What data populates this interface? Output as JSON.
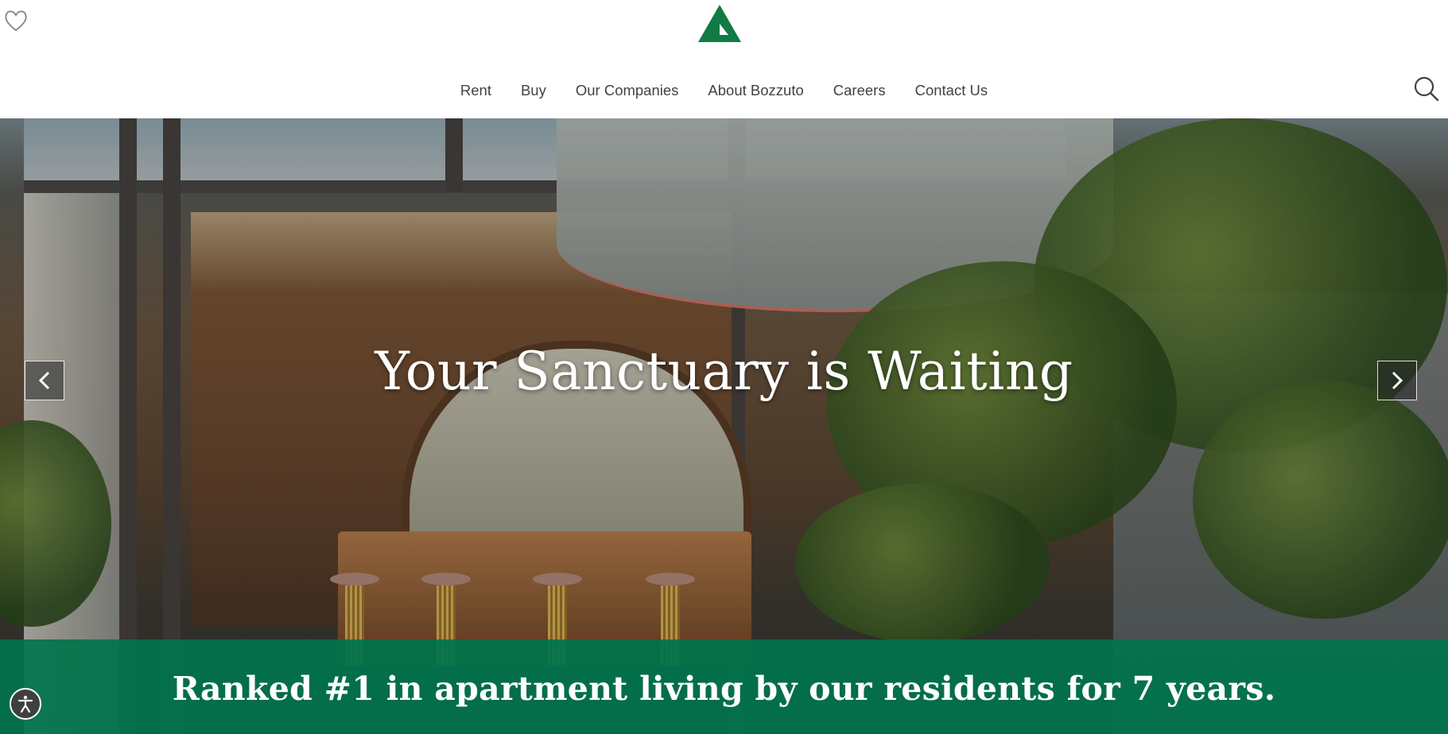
{
  "header": {
    "favorites_icon": "heart-outline-icon",
    "logo_icon": "bozzuto-triangle-logo",
    "brand_color": "#117a45",
    "nav": [
      {
        "label": "Rent"
      },
      {
        "label": "Buy"
      },
      {
        "label": "Our Companies"
      },
      {
        "label": "About Bozzuto"
      },
      {
        "label": "Careers"
      },
      {
        "label": "Contact Us"
      }
    ],
    "search_icon": "search-icon"
  },
  "hero": {
    "title": "Your Sanctuary is Waiting",
    "prev_icon": "chevron-left-icon",
    "next_icon": "chevron-right-icon"
  },
  "banner": {
    "text": "Ranked #1 in apartment living by our residents for 7 years.",
    "color": "#00744c"
  },
  "accessibility": {
    "icon": "accessibility-icon"
  }
}
